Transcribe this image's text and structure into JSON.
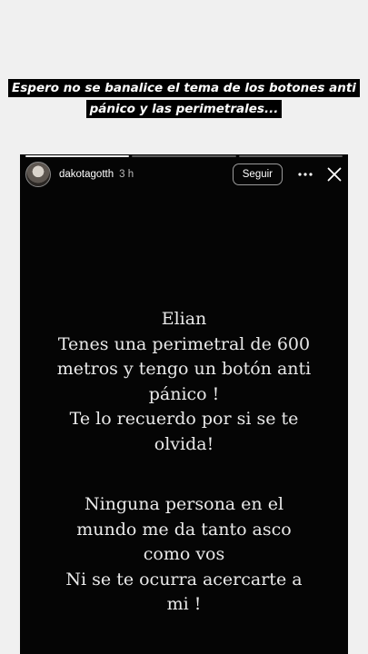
{
  "caption": {
    "line1": "Espero no se banalice el tema de los botones anti",
    "line2": "pánico y las perimetrales..."
  },
  "story": {
    "segments": 3,
    "active_segment": 1,
    "header": {
      "username": "dakotagotth",
      "time": "3 h",
      "follow_label": "Seguir",
      "more_icon": "more-horizontal-icon",
      "close_icon": "close-icon"
    },
    "text": {
      "paragraph1": [
        "Elian",
        "Tenes una perimetral de 600",
        "metros y tengo un botón anti",
        "pánico !",
        "Te lo recuerdo por si se te",
        "olvida!"
      ],
      "paragraph2": [
        "Ninguna persona en el",
        "mundo me da tanto asco",
        "como vos",
        "Ni se te ocurra acercarte a",
        "mi !"
      ]
    }
  },
  "colors": {
    "page_background": "#f0f0f0",
    "story_background": "#050505",
    "text": "#e9e9e9"
  }
}
